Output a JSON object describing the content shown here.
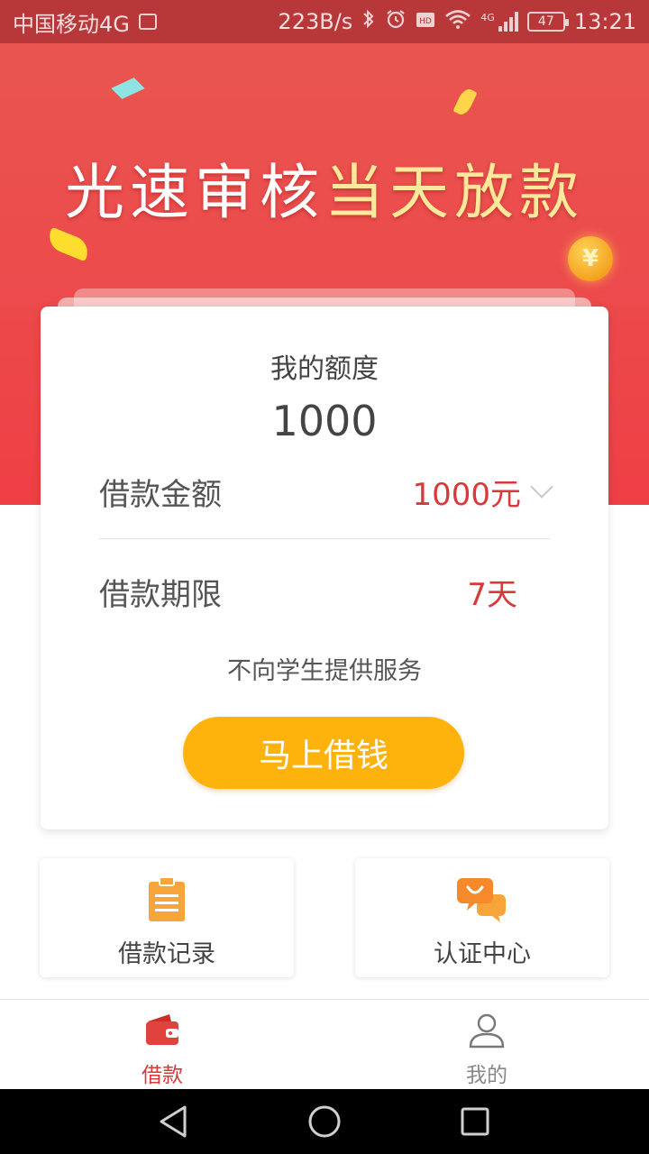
{
  "status_bar": {
    "carrier": "中国移动4G",
    "speed": "223B/s",
    "network": "4G",
    "battery": "47",
    "time": "13:21",
    "icons": [
      "image-icon",
      "bluetooth-icon",
      "alarm-icon",
      "hd-icon",
      "wifi-icon",
      "signal-icon",
      "battery-icon"
    ]
  },
  "banner": {
    "title_white": "光速审核",
    "title_yellow": "当天放款",
    "coin_symbol": "¥",
    "colors": {
      "white": "#ffffff",
      "yellow": "#ffe89a",
      "red": "#ec4b4c"
    }
  },
  "card": {
    "quota_label": "我的额度",
    "quota_value": "1000",
    "amount_label": "借款金额",
    "amount_value": "1000元",
    "term_label": "借款期限",
    "term_value": "7天",
    "notice": "不向学生提供服务",
    "cta_label": "马上借钱",
    "accent_color": "#d73a3a",
    "cta_color": "#fdb30c"
  },
  "tiles": [
    {
      "label": "借款记录",
      "icon": "clipboard-icon"
    },
    {
      "label": "认证中心",
      "icon": "chat-bubbles-icon"
    }
  ],
  "bottom_nav": {
    "items": [
      {
        "label": "借款",
        "icon": "wallet-icon",
        "active": true
      },
      {
        "label": "我的",
        "icon": "user-icon",
        "active": false
      }
    ]
  },
  "system_nav": {
    "icons": [
      "back-icon",
      "home-icon",
      "recents-icon"
    ]
  }
}
